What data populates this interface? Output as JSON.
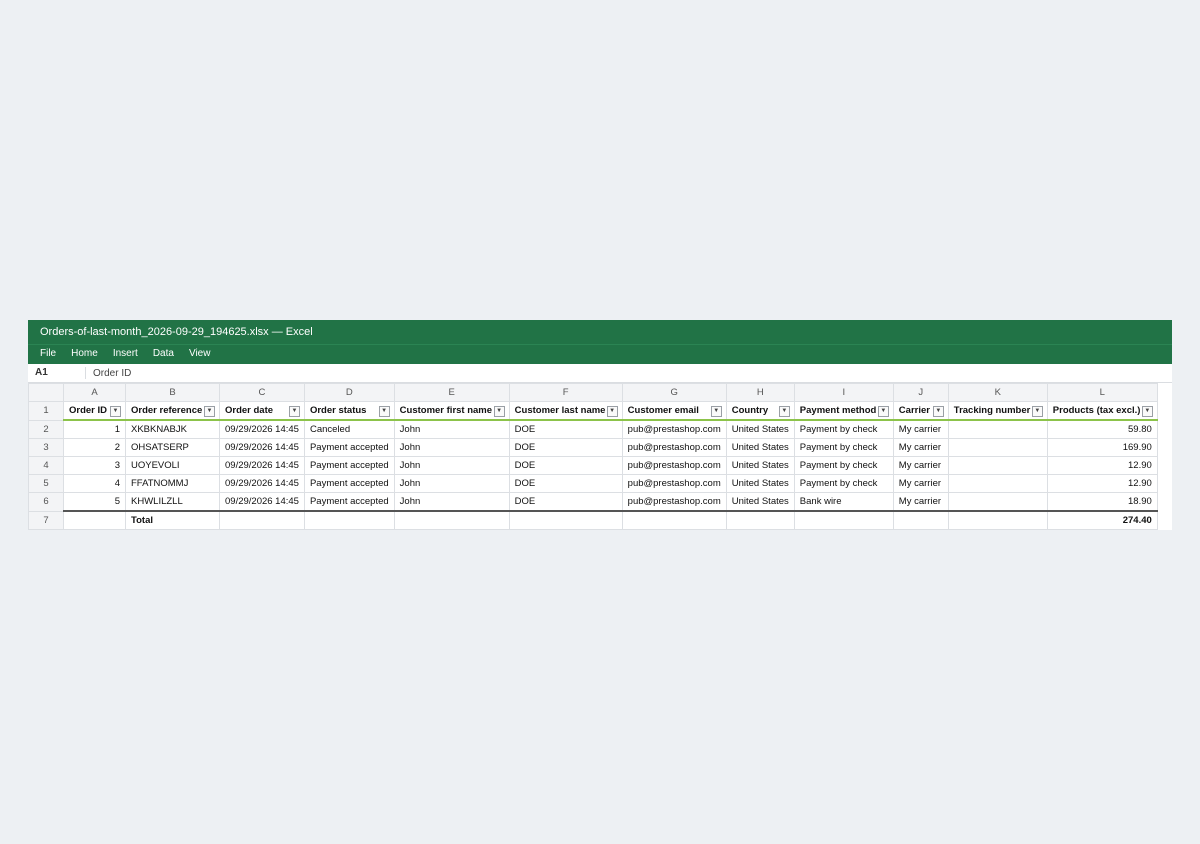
{
  "window": {
    "title": "Orders-of-last-month_2026-09-29_194625.xlsx — Excel"
  },
  "menu": [
    "File",
    "Home",
    "Insert",
    "Data",
    "View"
  ],
  "formula_bar": {
    "cell_ref": "A1",
    "content": "Order ID"
  },
  "columns": [
    "A",
    "B",
    "C",
    "D",
    "E",
    "F",
    "G",
    "H",
    "I",
    "J",
    "K",
    "L"
  ],
  "row_numbers": [
    "1",
    "2",
    "3",
    "4",
    "5",
    "6",
    "7"
  ],
  "headers": [
    "Order ID",
    "Order reference",
    "Order date",
    "Order status",
    "Customer first name",
    "Customer last name",
    "Customer email",
    "Country",
    "Payment method",
    "Carrier",
    "Tracking number",
    "Products (tax excl.)"
  ],
  "rows": [
    [
      "1",
      "XKBKNABJK",
      "09/29/2026 14:45",
      "Canceled",
      "John",
      "DOE",
      "pub@prestashop.com",
      "United States",
      "Payment by check",
      "My carrier",
      "",
      "59.80"
    ],
    [
      "2",
      "OHSATSERP",
      "09/29/2026 14:45",
      "Payment accepted",
      "John",
      "DOE",
      "pub@prestashop.com",
      "United States",
      "Payment by check",
      "My carrier",
      "",
      "169.90"
    ],
    [
      "3",
      "UOYEVOLI",
      "09/29/2026 14:45",
      "Payment accepted",
      "John",
      "DOE",
      "pub@prestashop.com",
      "United States",
      "Payment by check",
      "My carrier",
      "",
      "12.90"
    ],
    [
      "4",
      "FFATNOMMJ",
      "09/29/2026 14:45",
      "Payment accepted",
      "John",
      "DOE",
      "pub@prestashop.com",
      "United States",
      "Payment by check",
      "My carrier",
      "",
      "12.90"
    ],
    [
      "5",
      "KHWLILZLL",
      "09/29/2026 14:45",
      "Payment accepted",
      "John",
      "DOE",
      "pub@prestashop.com",
      "United States",
      "Bank wire",
      "My carrier",
      "",
      "18.90"
    ]
  ],
  "total": {
    "label": "Total",
    "value": "274.40"
  },
  "filter_icon": "filter-dropdown-icon",
  "colors": {
    "ribbon": "#217346",
    "header_underline": "#8cc34a"
  }
}
